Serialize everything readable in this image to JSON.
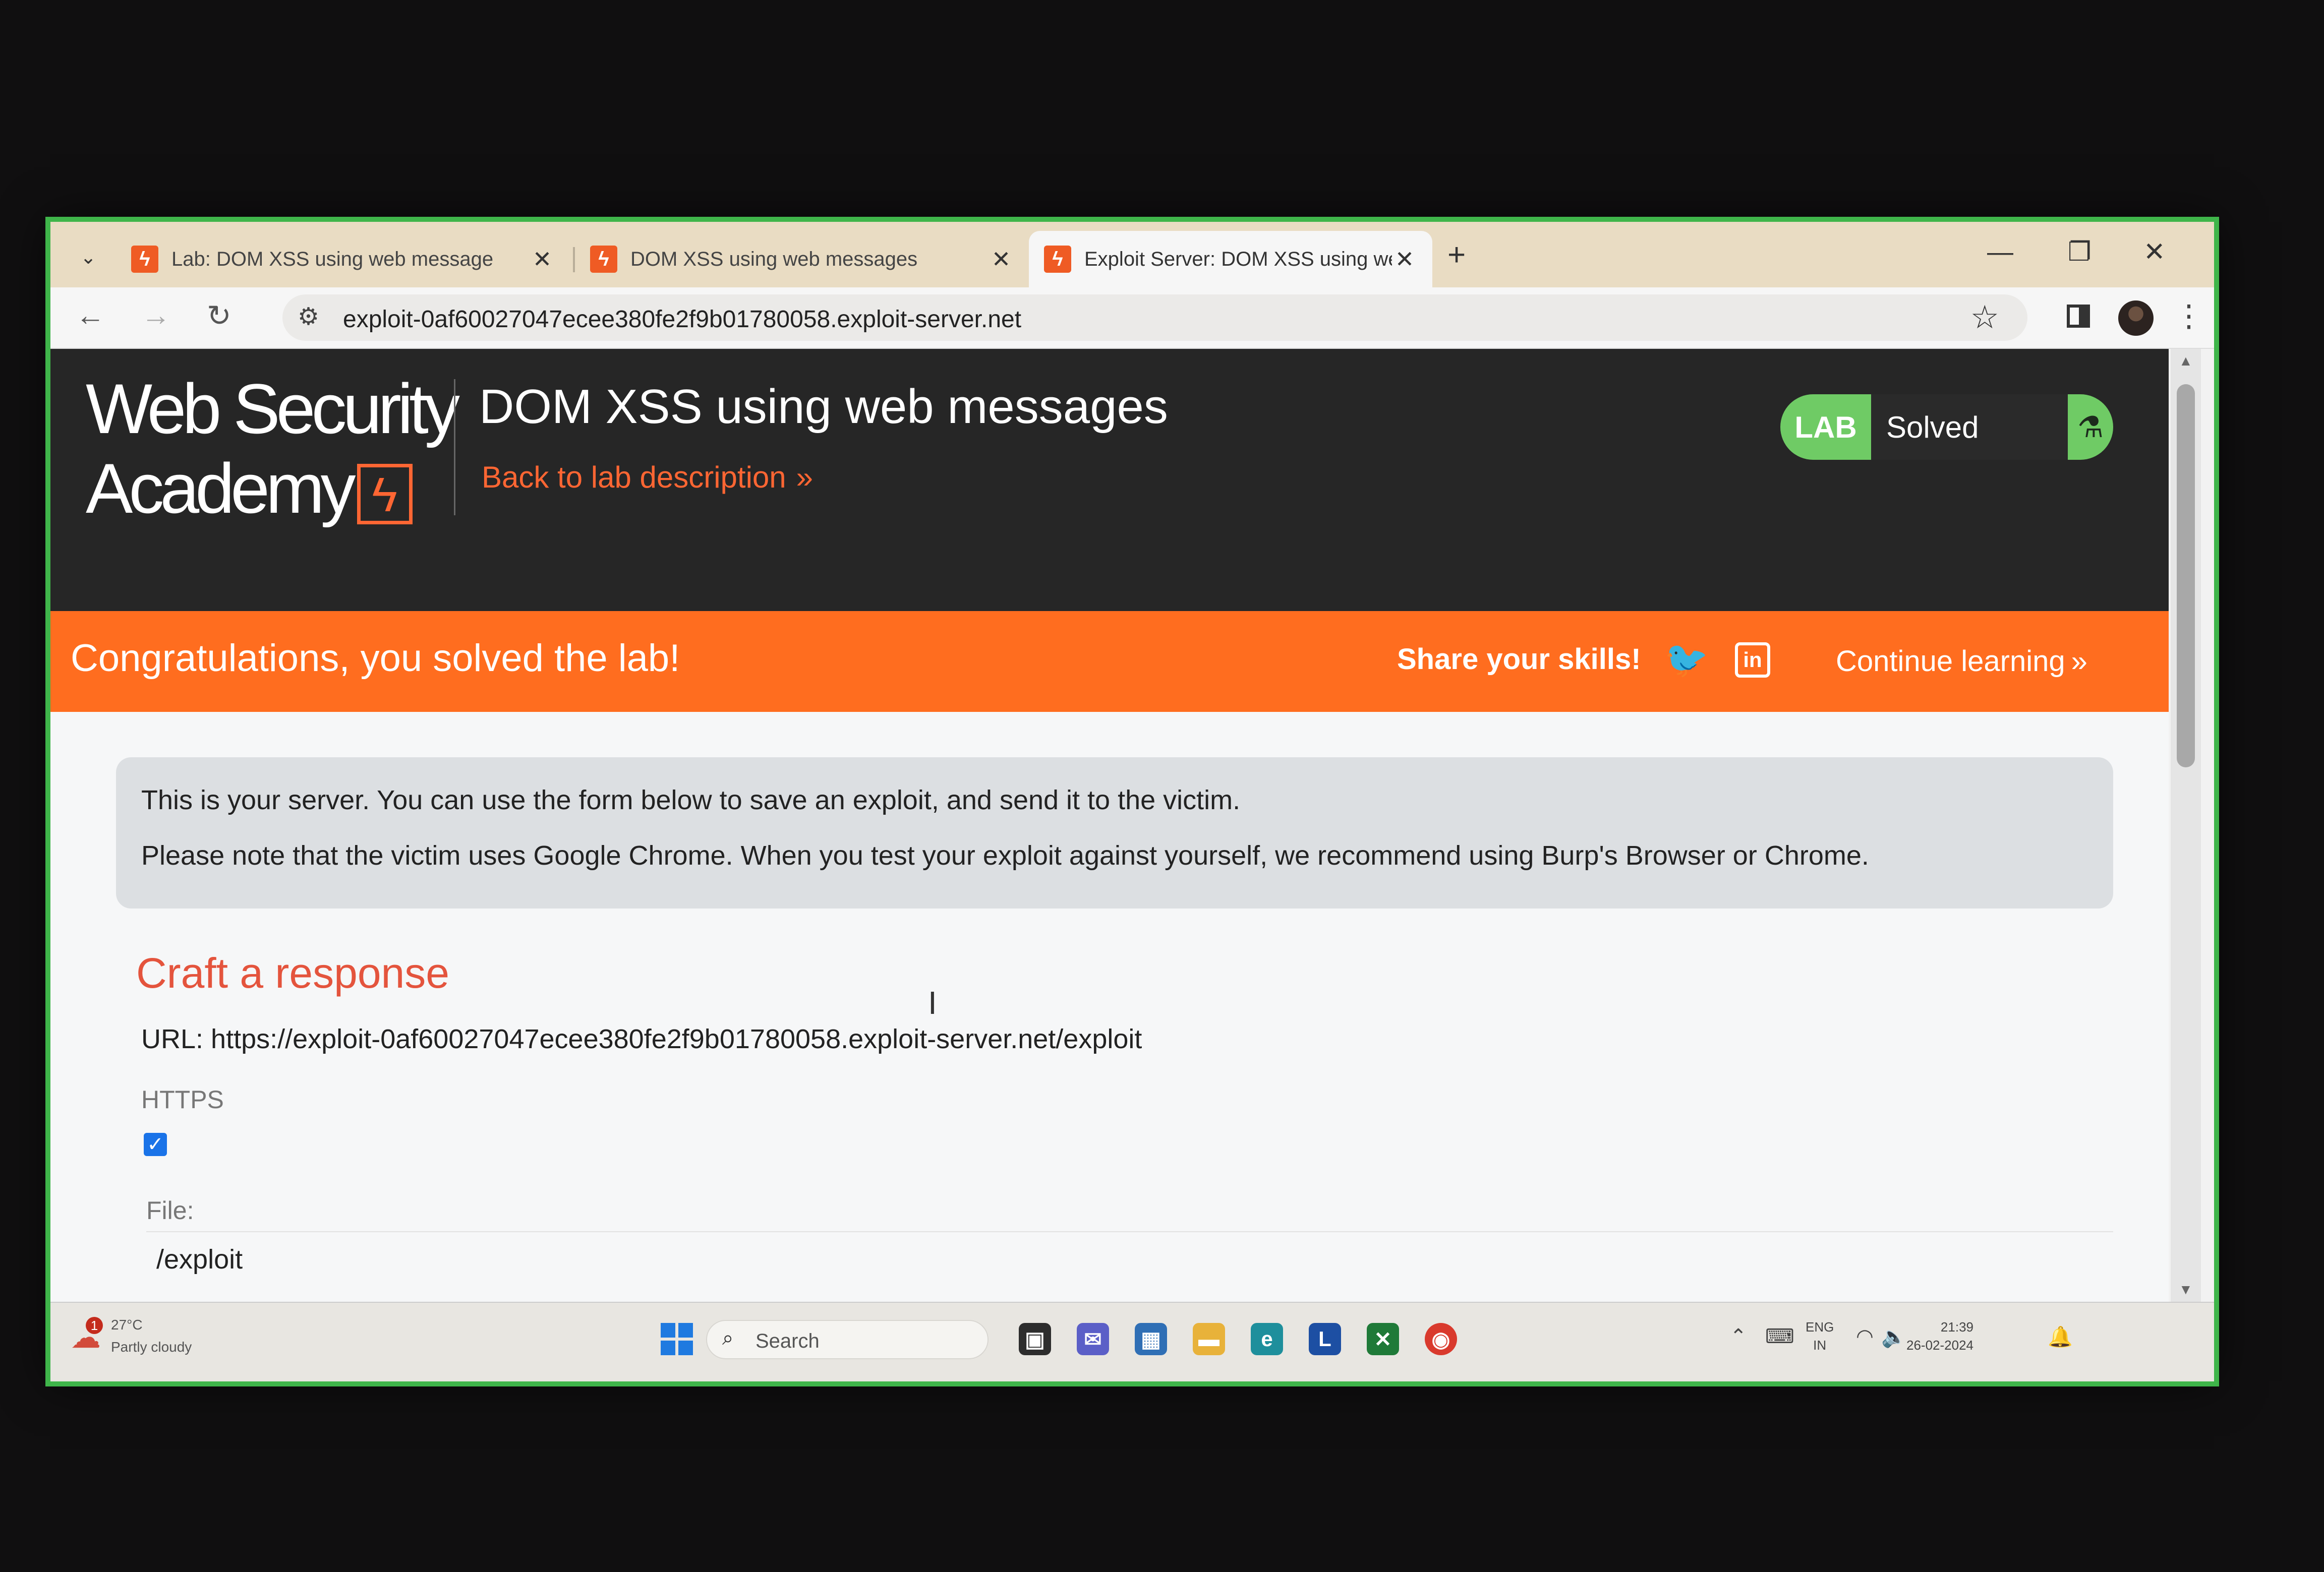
{
  "browser": {
    "tabs": [
      {
        "title": "Lab: DOM XSS using web message",
        "active": false
      },
      {
        "title": "DOM XSS using web messages",
        "active": false
      },
      {
        "title": "Exploit Server: DOM XSS using we",
        "active": true
      }
    ],
    "url": "exploit-0af60027047ecee380fe2f9b01780058.exploit-server.net"
  },
  "header": {
    "logo_line1": "Web Security",
    "logo_line2": "Academy",
    "title": "DOM XSS using web messages",
    "back_link": "Back to lab description",
    "status_badge": "LAB",
    "status_text": "Solved"
  },
  "banner": {
    "message": "Congratulations, you solved the lab!",
    "share": "Share your skills!",
    "continue": "Continue learning"
  },
  "info": {
    "line1": "This is your server. You can use the form below to save an exploit, and send it to the victim.",
    "line2": "Please note that the victim uses Google Chrome. When you test your exploit against yourself, we recommend using Burp's Browser or Chrome."
  },
  "form": {
    "heading": "Craft a response",
    "url_line": "URL: https://exploit-0af60027047ecee380fe2f9b01780058.exploit-server.net/exploit",
    "https_label": "HTTPS",
    "https_checked": true,
    "file_label": "File:",
    "file_value": "/exploit"
  },
  "taskbar": {
    "weather_temp": "27°C",
    "weather_desc": "Partly cloudy",
    "weather_alert": "1",
    "search_placeholder": "Search",
    "lang_line1": "ENG",
    "lang_line2": "IN",
    "time": "21:39",
    "date": "26-02-2024"
  },
  "colors": {
    "brand_orange": "#ff6633",
    "banner_orange": "#ff6d1f",
    "header_dark": "#262626",
    "solved_green": "#6fcb65",
    "craft_red": "#e4543d"
  }
}
